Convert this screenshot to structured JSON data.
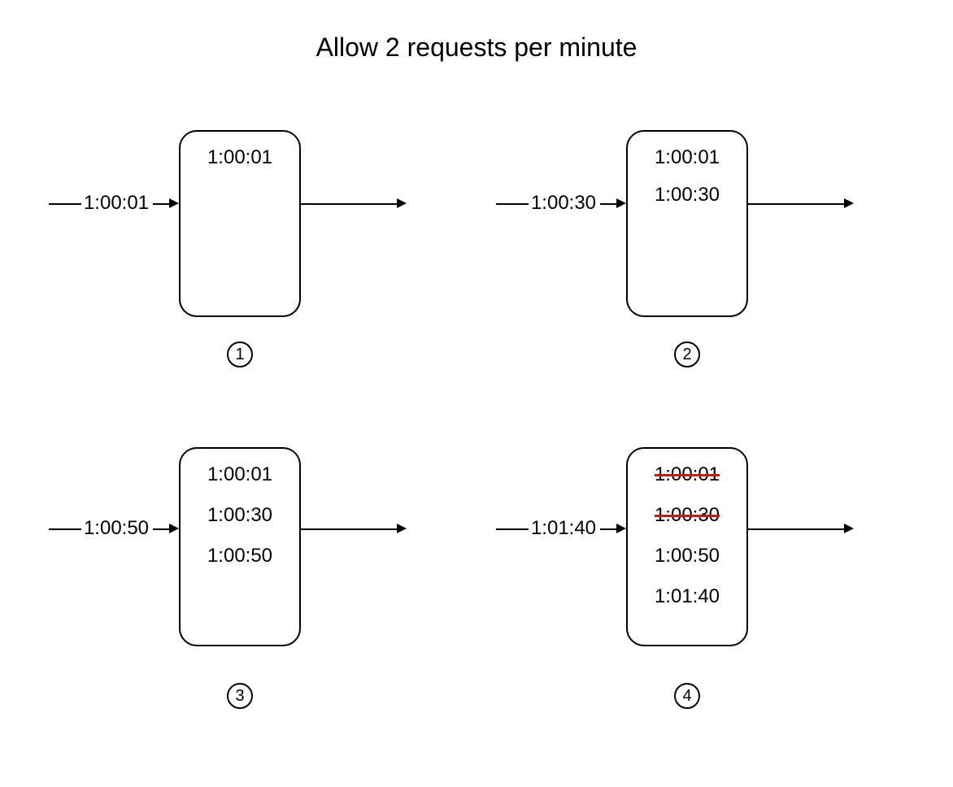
{
  "title": "Allow 2 requests per minute",
  "panels": [
    {
      "step": "1",
      "incoming": "1:00:01",
      "entries": [
        {
          "time": "1:00:01",
          "struck": false
        }
      ]
    },
    {
      "step": "2",
      "incoming": "1:00:30",
      "entries": [
        {
          "time": "1:00:01",
          "struck": false
        },
        {
          "time": "1:00:30",
          "struck": false
        }
      ]
    },
    {
      "step": "3",
      "incoming": "1:00:50",
      "entries": [
        {
          "time": "1:00:01",
          "struck": false
        },
        {
          "time": "1:00:30",
          "struck": false
        },
        {
          "time": "1:00:50",
          "struck": false
        }
      ]
    },
    {
      "step": "4",
      "incoming": "1:01:40",
      "entries": [
        {
          "time": "1:00:01",
          "struck": true
        },
        {
          "time": "1:00:30",
          "struck": true
        },
        {
          "time": "1:00:50",
          "struck": false
        },
        {
          "time": "1:01:40",
          "struck": false
        }
      ]
    }
  ]
}
